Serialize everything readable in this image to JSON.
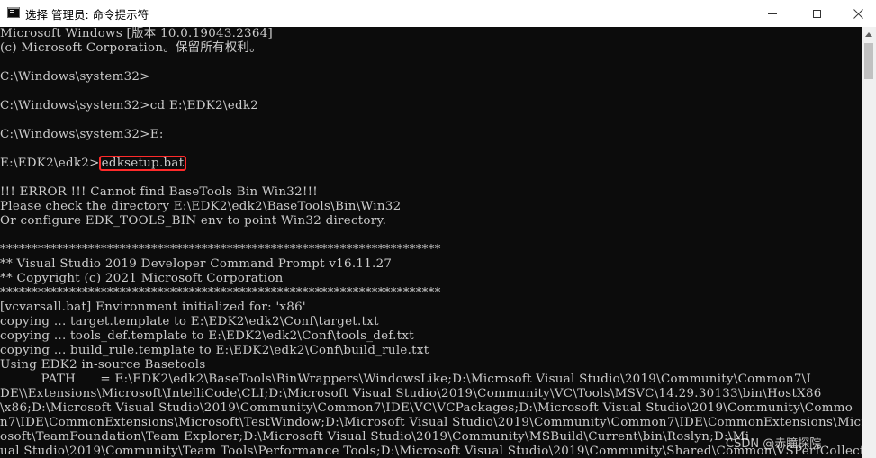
{
  "window": {
    "title": "选择 管理员: 命令提示符"
  },
  "console": {
    "lines": [
      {
        "text": "Microsoft Windows [版本 10.0.19043.2364]"
      },
      {
        "text": "(c) Microsoft Corporation。保留所有权利。"
      },
      {
        "text": ""
      },
      {
        "text": "C:\\Windows\\system32>"
      },
      {
        "text": ""
      },
      {
        "text": "C:\\Windows\\system32>cd E:\\EDK2\\edk2"
      },
      {
        "text": ""
      },
      {
        "text": "C:\\Windows\\system32>E:"
      },
      {
        "text": ""
      },
      {
        "text": "E:\\EDK2\\edk2>",
        "highlight": "edksetup.bat"
      },
      {
        "text": ""
      },
      {
        "text": "!!! ERROR !!! Cannot find BaseTools Bin Win32!!!"
      },
      {
        "text": "Please check the directory E:\\EDK2\\edk2\\BaseTools\\Bin\\Win32"
      },
      {
        "text": "Or configure EDK_TOOLS_BIN env to point Win32 directory."
      },
      {
        "text": ""
      },
      {
        "text": "**********************************************************************"
      },
      {
        "text": "** Visual Studio 2019 Developer Command Prompt v16.11.27"
      },
      {
        "text": "** Copyright (c) 2021 Microsoft Corporation"
      },
      {
        "text": "**********************************************************************"
      },
      {
        "text": "[vcvarsall.bat] Environment initialized for: 'x86'"
      },
      {
        "text": "copying ... target.template to E:\\EDK2\\edk2\\Conf\\target.txt"
      },
      {
        "text": "copying ... tools_def.template to E:\\EDK2\\edk2\\Conf\\tools_def.txt"
      },
      {
        "text": "copying ... build_rule.template to E:\\EDK2\\edk2\\Conf\\build_rule.txt"
      },
      {
        "text": "Using EDK2 in-source Basetools"
      },
      {
        "text": "          PATH      = E:\\EDK2\\edk2\\BaseTools\\BinWrappers\\WindowsLike;D:\\Microsoft Visual Studio\\2019\\Community\\Common7\\I"
      },
      {
        "text": "DE\\\\Extensions\\Microsoft\\IntelliCode\\CLI;D:\\Microsoft Visual Studio\\2019\\Community\\VC\\Tools\\MSVC\\14.29.30133\\bin\\HostX86"
      },
      {
        "text": "\\x86;D:\\Microsoft Visual Studio\\2019\\Community\\Common7\\IDE\\VC\\VCPackages;D:\\Microsoft Visual Studio\\2019\\Community\\Commo"
      },
      {
        "text": "n7\\IDE\\CommonExtensions\\Microsoft\\TestWindow;D:\\Microsoft Visual Studio\\2019\\Community\\Common7\\IDE\\CommonExtensions\\Micr"
      },
      {
        "text": "osoft\\TeamFoundation\\Team Explorer;D:\\Microsoft Visual Studio\\2019\\Community\\MSBuild\\Current\\bin\\Roslyn;D:\\Mi"
      },
      {
        "text": "ual Studio\\2019\\Community\\Team Tools\\Performance Tools;D:\\Microsoft Visual Studio\\2019\\Community\\Shared\\Common\\VSPerfCollectionTools\\vs"
      }
    ]
  },
  "watermark": "CSDN @赤瞳探院",
  "colors": {
    "console_bg": "#0c0c0c",
    "console_fg": "#cccccc",
    "highlight_border": "#ff2a2a"
  }
}
